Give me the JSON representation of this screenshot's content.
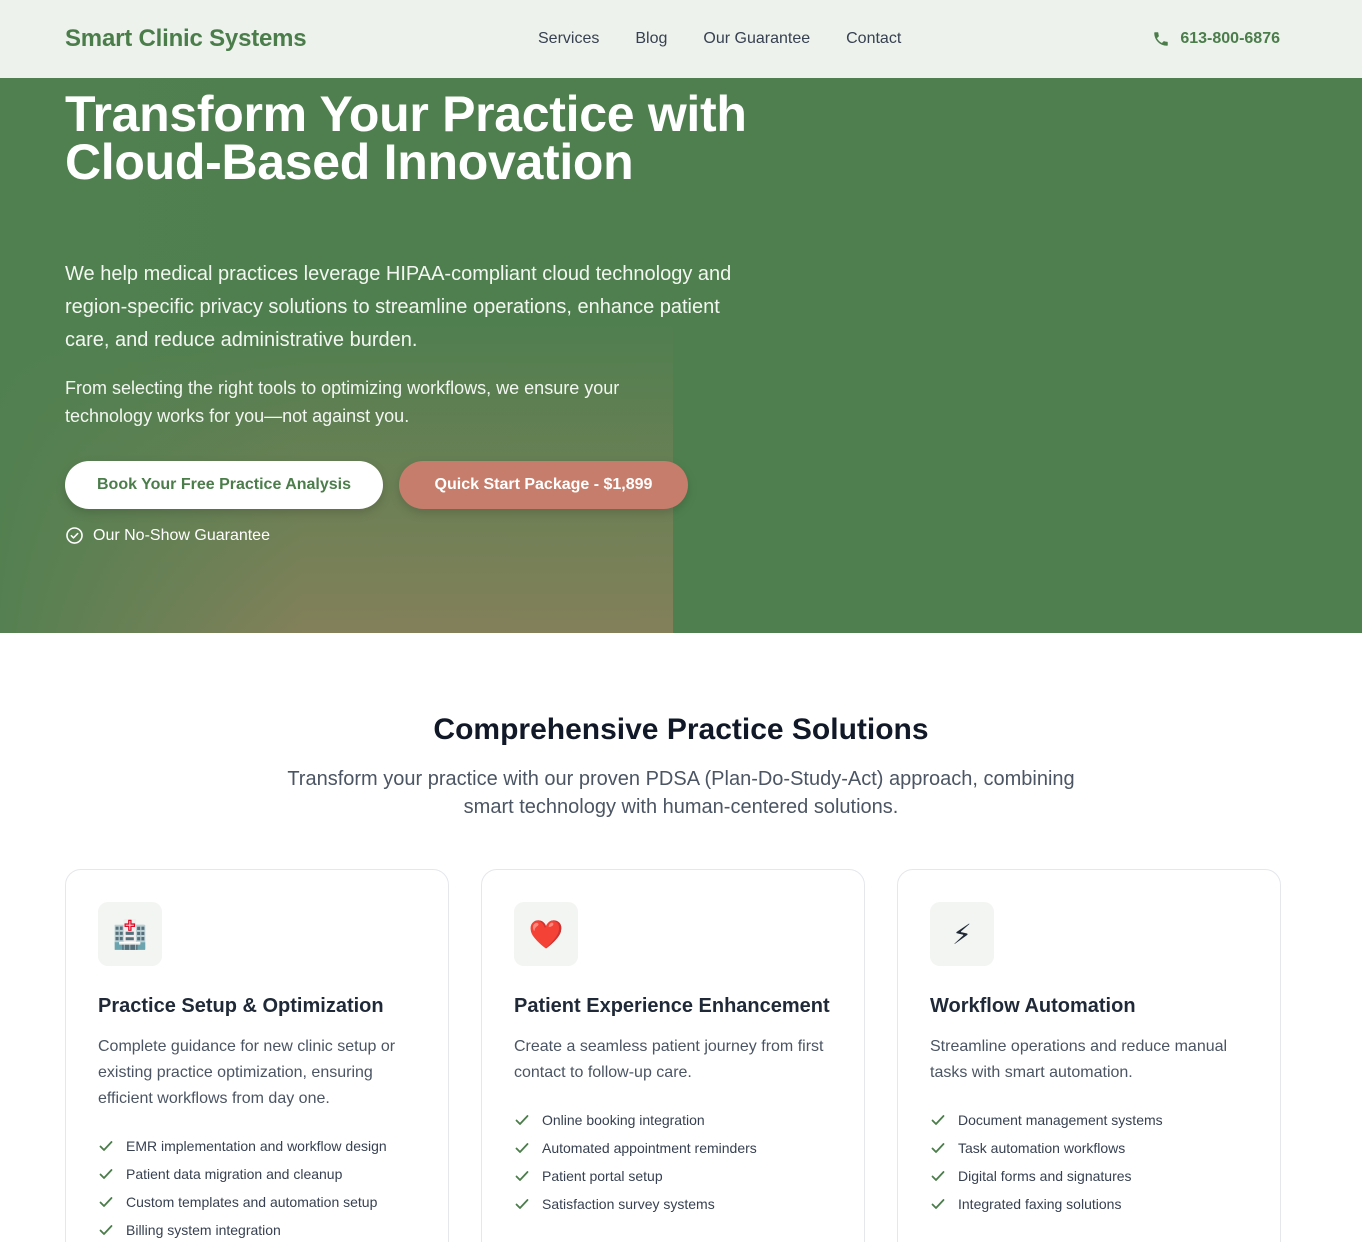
{
  "header": {
    "brand": "Smart Clinic Systems",
    "nav": [
      "Services",
      "Blog",
      "Our Guarantee",
      "Contact"
    ],
    "phone": "613-800-6876",
    "phone_icon": "phone-icon"
  },
  "hero": {
    "title": "Transform Your Practice with Cloud-Based Innovation",
    "p1": "We help medical practices leverage HIPAA-compliant cloud technology and region-specific privacy solutions to streamline operations, enhance patient care, and reduce administrative burden.",
    "p2": "From selecting the right tools to optimizing workflows, we ensure your technology works for you—not against you.",
    "cta_primary": "Book Your Free Practice Analysis",
    "cta_secondary": "Quick Start Package - $1,899",
    "guarantee": "Our No-Show Guarantee",
    "guarantee_icon": "check-circle-icon"
  },
  "solutions": {
    "title": "Comprehensive Practice Solutions",
    "subtitle": "Transform your practice with our proven PDSA (Plan-Do-Study-Act) approach, combining smart technology with human-centered solutions.",
    "cards": [
      {
        "icon": "🏥",
        "icon_name": "hospital-icon",
        "title": "Practice Setup & Optimization",
        "desc": "Complete guidance for new clinic setup or existing practice optimization, ensuring efficient workflows from day one.",
        "items": [
          "EMR implementation and workflow design",
          "Patient data migration and cleanup",
          "Custom templates and automation setup",
          "Billing system integration"
        ]
      },
      {
        "icon": "❤️",
        "icon_name": "heart-icon",
        "title": "Patient Experience Enhancement",
        "desc": "Create a seamless patient journey from first contact to follow-up care.",
        "items": [
          "Online booking integration",
          "Automated appointment reminders",
          "Patient portal setup",
          "Satisfaction survey systems"
        ]
      },
      {
        "icon": "⚡",
        "icon_name": "lightning-icon",
        "title": "Workflow Automation",
        "desc": "Streamline operations and reduce manual tasks with smart automation.",
        "items": [
          "Document management systems",
          "Task automation workflows",
          "Digital forms and signatures",
          "Integrated faxing solutions"
        ]
      }
    ]
  },
  "colors": {
    "brand_green": "#4b7d4b",
    "hero_green": "#4f7f4f",
    "cta_rose": "#c67d6b"
  }
}
